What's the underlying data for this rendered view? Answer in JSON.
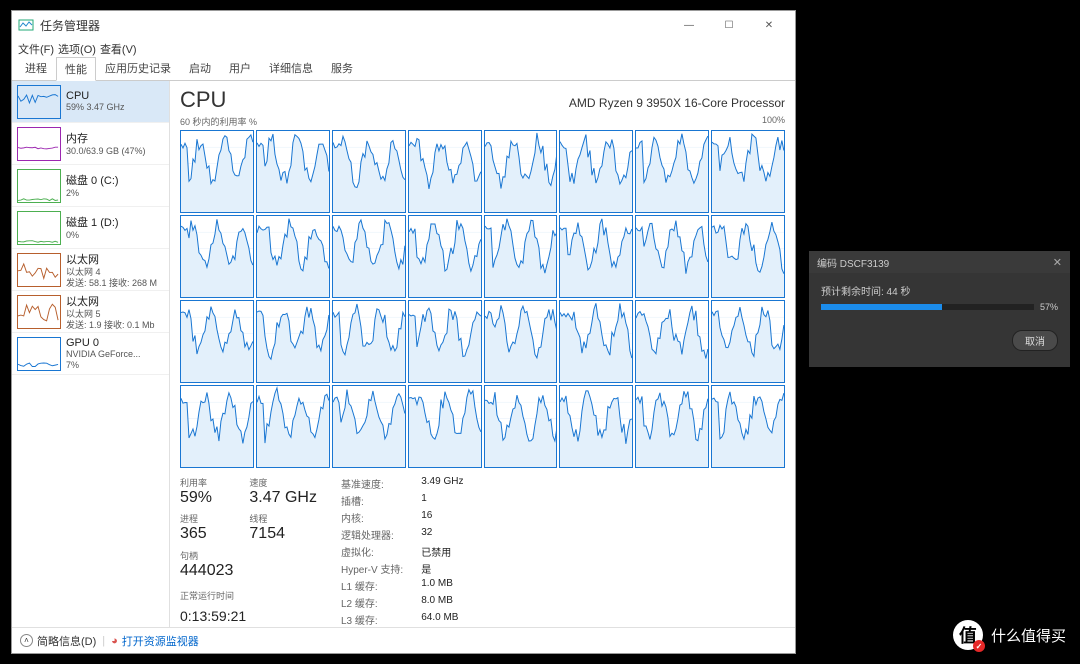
{
  "taskmgr": {
    "title": "任务管理器",
    "winbtns": {
      "min": "—",
      "max": "☐",
      "close": "✕"
    },
    "menus": [
      "文件(F)",
      "选项(O)",
      "查看(V)"
    ],
    "tabs": [
      "进程",
      "性能",
      "应用历史记录",
      "启动",
      "用户",
      "详细信息",
      "服务"
    ],
    "active_tab": 1,
    "sidebar": [
      {
        "title": "CPU",
        "sub1": "59%  3.47 GHz",
        "sub2": "",
        "border": "#1976d2",
        "selected": true
      },
      {
        "title": "内存",
        "sub1": "30.0/63.9 GB (47%)",
        "sub2": "",
        "border": "#9c27b0"
      },
      {
        "title": "磁盘 0 (C:)",
        "sub1": "2%",
        "sub2": "",
        "border": "#4caf50"
      },
      {
        "title": "磁盘 1 (D:)",
        "sub1": "0%",
        "sub2": "",
        "border": "#4caf50"
      },
      {
        "title": "以太网",
        "sub1": "以太网 4",
        "sub2": "发送: 58.1  接收: 268 M",
        "border": "#b75f2d"
      },
      {
        "title": "以太网",
        "sub1": "以太网 5",
        "sub2": "发送: 1.9  接收: 0.1 Mb",
        "border": "#b75f2d"
      },
      {
        "title": "GPU 0",
        "sub1": "NVIDIA GeForce...",
        "sub2": "7%",
        "border": "#1976d2"
      }
    ],
    "main": {
      "heading": "CPU",
      "cpu_name": "AMD Ryzen 9 3950X 16-Core Processor",
      "chart_left_label": "60 秒内的利用率 %",
      "chart_right_label": "100%",
      "stats1": {
        "util_lbl": "利用率",
        "util": "59%",
        "speed_lbl": "速度",
        "speed": "3.47 GHz",
        "proc_lbl": "进程",
        "proc": "365",
        "thr_lbl": "线程",
        "thr": "7154",
        "hnd_lbl": "句柄",
        "hnd": "444023",
        "uptime_lbl": "正常运行时间",
        "uptime": "0:13:59:21"
      },
      "stats2": [
        [
          "基准速度:",
          "3.49 GHz"
        ],
        [
          "插槽:",
          "1"
        ],
        [
          "内核:",
          "16"
        ],
        [
          "逻辑处理器:",
          "32"
        ],
        [
          "虚拟化:",
          "已禁用"
        ],
        [
          "Hyper-V 支持:",
          "是"
        ],
        [
          "L1 缓存:",
          "1.0 MB"
        ],
        [
          "L2 缓存:",
          "8.0 MB"
        ],
        [
          "L3 缓存:",
          "64.0 MB"
        ]
      ]
    },
    "footer": {
      "collapse": "简略信息(D)",
      "link": "打开资源监视器"
    }
  },
  "encoder": {
    "title": "编码 DSCF3139",
    "eta_label": "预计剩余时间: 44 秒",
    "percent": 57,
    "percent_text": "57%",
    "cancel": "取消"
  },
  "watermark": {
    "text": "什么值得买",
    "badge": "值"
  },
  "chart_data": {
    "type": "line",
    "note": "32 per-logical-processor utilization sparklines over last 60s; displayed as 8×4 small multiples. Values approximate, read from chart shapes.",
    "xlabel": "60 秒内的利用率 %",
    "ylim": [
      0,
      100
    ],
    "series_count": 32,
    "approximate_current_utilization_percent": [
      70,
      65,
      60,
      62,
      58,
      55,
      60,
      58,
      55,
      62,
      58,
      50,
      55,
      52,
      60,
      58,
      48,
      62,
      55,
      50,
      56,
      54,
      62,
      58,
      45,
      60,
      52,
      48,
      55,
      50,
      62,
      56
    ],
    "overall_utilization_percent": 59
  }
}
